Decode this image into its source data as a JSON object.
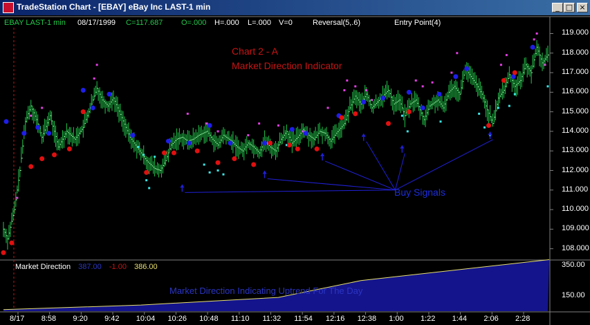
{
  "window": {
    "title": "TradeStation Chart - [EBAY] eBay Inc LAST-1 min",
    "controls": {
      "minimize": "_",
      "maximize": "□",
      "close": "×"
    }
  },
  "header": {
    "symbol": "EBAY LAST-1 min",
    "date": "08/17/1999",
    "close": "C=117.687",
    "open": "O=.000",
    "high": "H=.000",
    "low": "L=.000",
    "volume": "V=0",
    "reversal": "Reversal(5,.6)",
    "entry": "Entry Point(4)"
  },
  "annotations": {
    "title": "Chart 2 - A",
    "subtitle": "Market Direction Indicator",
    "buy_signals": "Buy Signals",
    "market_direction_note": "Market Direction Indicating Uptrend For The Day"
  },
  "subchart": {
    "label": "Market Direction",
    "value1": "387.00",
    "value2": "-1.00",
    "value3": "386.00"
  },
  "colors": {
    "bars": "#22c84a",
    "reversal_high": "#1e1ee8",
    "reversal_low": "#e01010",
    "magenta": "#e23ee2",
    "cyan": "#3ce6e6",
    "arrow": "#2020d8",
    "subchart_fill": "#14148c"
  },
  "axis": {
    "y_ticks": [
      "119.000",
      "118.000",
      "117.000",
      "116.000",
      "115.000",
      "114.000",
      "113.000",
      "112.000",
      "111.000",
      "110.000",
      "109.000",
      "108.000"
    ],
    "sub_ticks": [
      "350.00",
      "150.00"
    ],
    "x_ticks": [
      "8/17",
      "8:58",
      "9:20",
      "9:42",
      "10:04",
      "10:26",
      "10:48",
      "11:10",
      "11:32",
      "11:54",
      "12:16",
      "12:38",
      "1:00",
      "1:22",
      "1:44",
      "2:06",
      "2:28"
    ]
  },
  "chart_data": {
    "type": "bar",
    "title": "Chart 2 - A",
    "subtitle": "Market Direction Indicator",
    "xlabel": "",
    "ylabel": "",
    "ylim": [
      107.6,
      119.3
    ],
    "sub_ylim": [
      50,
      380
    ],
    "x_ticks": [
      "8/17",
      "8:58",
      "9:20",
      "9:42",
      "10:04",
      "10:26",
      "10:48",
      "11:10",
      "11:32",
      "11:54",
      "12:16",
      "12:38",
      "1:00",
      "1:22",
      "1:44",
      "2:06",
      "2:28"
    ],
    "price_keypoints": [
      [
        0,
        109.0
      ],
      [
        3,
        108.5
      ],
      [
        8,
        110.0
      ],
      [
        12,
        112.0
      ],
      [
        16,
        114.5
      ],
      [
        20,
        115.3
      ],
      [
        24,
        114.6
      ],
      [
        28,
        113.7
      ],
      [
        34,
        114.8
      ],
      [
        40,
        113.2
      ],
      [
        46,
        114.0
      ],
      [
        52,
        113.6
      ],
      [
        58,
        114.2
      ],
      [
        64,
        115.4
      ],
      [
        68,
        116.2
      ],
      [
        72,
        115.6
      ],
      [
        76,
        115.3
      ],
      [
        80,
        115.7
      ],
      [
        86,
        114.7
      ],
      [
        92,
        113.7
      ],
      [
        98,
        113.1
      ],
      [
        104,
        112.5
      ],
      [
        110,
        112.1
      ],
      [
        114,
        112.0
      ],
      [
        118,
        112.5
      ],
      [
        122,
        113.3
      ],
      [
        126,
        113.6
      ],
      [
        130,
        113.7
      ],
      [
        134,
        113.5
      ],
      [
        138,
        113.6
      ],
      [
        142,
        113.8
      ],
      [
        148,
        114.0
      ],
      [
        152,
        113.6
      ],
      [
        156,
        113.3
      ],
      [
        160,
        113.8
      ],
      [
        166,
        113.5
      ],
      [
        170,
        113.2
      ],
      [
        174,
        113.0
      ],
      [
        178,
        113.4
      ],
      [
        182,
        113.2
      ],
      [
        186,
        112.9
      ],
      [
        190,
        113.5
      ],
      [
        194,
        113.2
      ],
      [
        198,
        113.0
      ],
      [
        202,
        113.6
      ],
      [
        206,
        114.0
      ],
      [
        210,
        113.4
      ],
      [
        214,
        113.7
      ],
      [
        218,
        114.1
      ],
      [
        222,
        113.8
      ],
      [
        226,
        113.6
      ],
      [
        230,
        114.0
      ],
      [
        234,
        113.9
      ],
      [
        238,
        113.5
      ],
      [
        242,
        113.9
      ],
      [
        248,
        114.4
      ],
      [
        252,
        115.2
      ],
      [
        256,
        115.8
      ],
      [
        260,
        115.4
      ],
      [
        264,
        115.9
      ],
      [
        268,
        115.2
      ],
      [
        272,
        115.5
      ],
      [
        276,
        115.8
      ],
      [
        280,
        116.1
      ],
      [
        284,
        115.4
      ],
      [
        288,
        115.6
      ],
      [
        292,
        114.8
      ],
      [
        296,
        115.4
      ],
      [
        300,
        115.6
      ],
      [
        306,
        114.6
      ],
      [
        310,
        115.3
      ],
      [
        316,
        115.6
      ],
      [
        320,
        115.2
      ],
      [
        324,
        116.0
      ],
      [
        328,
        116.3
      ],
      [
        332,
        115.9
      ],
      [
        336,
        117.2
      ],
      [
        340,
        116.8
      ],
      [
        344,
        116.4
      ],
      [
        348,
        115.9
      ],
      [
        352,
        115.1
      ],
      [
        356,
        114.4
      ],
      [
        360,
        115.7
      ],
      [
        364,
        116.1
      ],
      [
        368,
        116.9
      ],
      [
        372,
        116.3
      ],
      [
        376,
        116.6
      ],
      [
        380,
        117.4
      ],
      [
        384,
        117.0
      ],
      [
        388,
        118.3
      ],
      [
        392,
        117.5
      ],
      [
        396,
        117.9
      ]
    ],
    "bar_count": 397,
    "reversal_highs": [
      [
        2,
        114.5
      ],
      [
        15,
        113.9
      ],
      [
        25,
        114.2
      ],
      [
        33,
        113.9
      ],
      [
        58,
        116.1
      ],
      [
        65,
        115.2
      ],
      [
        77,
        115.9
      ],
      [
        94,
        113.8
      ],
      [
        120,
        113.5
      ],
      [
        135,
        113.4
      ],
      [
        150,
        114.3
      ],
      [
        165,
        113.4
      ],
      [
        190,
        113.4
      ],
      [
        210,
        114.1
      ],
      [
        220,
        113.9
      ],
      [
        244,
        114.8
      ],
      [
        262,
        115.5
      ],
      [
        276,
        115.7
      ],
      [
        295,
        116.0
      ],
      [
        305,
        115.2
      ],
      [
        317,
        115.9
      ],
      [
        329,
        116.8
      ],
      [
        337,
        117.2
      ],
      [
        371,
        116.8
      ],
      [
        385,
        118.3
      ]
    ],
    "reversal_lows": [
      [
        0,
        107.8
      ],
      [
        6,
        108.3
      ],
      [
        20,
        112.2
      ],
      [
        28,
        112.6
      ],
      [
        37,
        112.8
      ],
      [
        48,
        113.1
      ],
      [
        58,
        115.0
      ],
      [
        104,
        111.9
      ],
      [
        117,
        112.9
      ],
      [
        124,
        112.9
      ],
      [
        141,
        113.0
      ],
      [
        156,
        112.4
      ],
      [
        168,
        112.6
      ],
      [
        182,
        112.3
      ],
      [
        194,
        113.4
      ],
      [
        208,
        113.3
      ],
      [
        214,
        113.1
      ],
      [
        228,
        113.1
      ],
      [
        246,
        114.7
      ],
      [
        256,
        114.9
      ],
      [
        280,
        114.4
      ],
      [
        295,
        115.0
      ],
      [
        353,
        114.3
      ],
      [
        364,
        116.6
      ],
      [
        372,
        117.0
      ]
    ],
    "magenta_points": [
      [
        10,
        110.6
      ],
      [
        20,
        114.8
      ],
      [
        28,
        115.2
      ],
      [
        66,
        116.7
      ],
      [
        68,
        117.4
      ],
      [
        134,
        114.9
      ],
      [
        148,
        114.4
      ],
      [
        156,
        114.0
      ],
      [
        178,
        113.8
      ],
      [
        186,
        114.4
      ],
      [
        200,
        114.3
      ],
      [
        218,
        114.0
      ],
      [
        236,
        115.2
      ],
      [
        248,
        116.1
      ],
      [
        250,
        116.6
      ],
      [
        256,
        116.3
      ],
      [
        264,
        116.1
      ],
      [
        268,
        115.6
      ],
      [
        300,
        116.6
      ],
      [
        305,
        116.3
      ],
      [
        312,
        116.5
      ],
      [
        326,
        117.0
      ],
      [
        330,
        118.0
      ],
      [
        362,
        117.4
      ],
      [
        366,
        117.9
      ],
      [
        386,
        118.7
      ],
      [
        388,
        119.0
      ],
      [
        394,
        117.4
      ]
    ],
    "cyan_points": [
      [
        98,
        113.2
      ],
      [
        102,
        112.8
      ],
      [
        104,
        111.5
      ],
      [
        106,
        111.1
      ],
      [
        110,
        112.7
      ],
      [
        146,
        112.3
      ],
      [
        150,
        111.9
      ],
      [
        156,
        112.0
      ],
      [
        160,
        111.8
      ],
      [
        206,
        113.3
      ],
      [
        290,
        114.8
      ],
      [
        294,
        114.0
      ],
      [
        318,
        114.5
      ],
      [
        346,
        114.9
      ],
      [
        350,
        114.2
      ],
      [
        354,
        113.8
      ],
      [
        360,
        115.2
      ],
      [
        368,
        115.3
      ],
      [
        372,
        115.9
      ],
      [
        396,
        116.3
      ]
    ],
    "arrow_points": [
      [
        130,
        111.3
      ],
      [
        190,
        112.0
      ],
      [
        232,
        112.9
      ],
      [
        262,
        113.9
      ],
      [
        290,
        113.3
      ],
      [
        354,
        114.0
      ]
    ],
    "buy_signal_target": [
      285,
      111.0
    ],
    "market_direction": [
      [
        0,
        60
      ],
      [
        100,
        90
      ],
      [
        200,
        140
      ],
      [
        260,
        250
      ],
      [
        300,
        290
      ],
      [
        397,
        387
      ]
    ]
  }
}
